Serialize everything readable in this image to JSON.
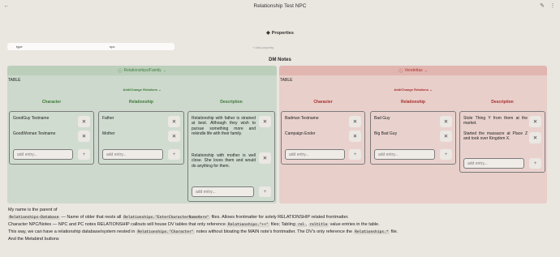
{
  "title": "Relationship Test NPC",
  "properties": {
    "heading": "Properties",
    "row": {
      "key": "type",
      "value": "npc"
    },
    "add_label": "+ Add property"
  },
  "dm_notes_title": "DM Notes",
  "relationships": {
    "header": "Relationships/Family",
    "table_label": "TABLE",
    "add_change": "Add/Change Relations",
    "columns": {
      "character": {
        "label": "Character",
        "entries": [
          "GoodGuy Testname",
          "GoodWoman Testname"
        ],
        "placeholder": "add entry..."
      },
      "relationship": {
        "label": "Relationship",
        "entries": [
          "Father",
          "Mother"
        ],
        "placeholder": "add entry..."
      },
      "description": {
        "label": "Description",
        "entries": [
          "Relationship with father is strained at best. Although they wish to pursue something more and rekindle life with their family.",
          "Relationship with mother is well close. She loves them and would do anything for them."
        ],
        "placeholder": "add entry..."
      }
    }
  },
  "vendettas": {
    "header": "Vendettas",
    "table_label": "TABLE",
    "add_change": "Add/Change Relations",
    "columns": {
      "character": {
        "label": "Character",
        "entries": [
          "Badman Testname",
          "Campaign Ender"
        ],
        "placeholder": "add entry..."
      },
      "relationship": {
        "label": "Relationship",
        "entries": [
          "Bad Guy",
          "Big Bad Guy"
        ],
        "placeholder": "add entry..."
      },
      "description": {
        "label": "Description",
        "entries": [
          "Stole Thing Y from them at the market.",
          "Started the massacre at Place Z and took over Kingdom X."
        ],
        "placeholder": "add entry..."
      }
    }
  },
  "footer": {
    "line1": "My name is the parent of",
    "line2_code1": "Relationships-Database",
    "line2_text1": " — Name of older that nests all ",
    "line2_code2": "Relationships.\"EnterCharacterNameHere\"",
    "line2_text2": " files. Allows frontmatter for solely RELATIONSHIP related frontmatter.",
    "line3_text1": "Character NPC/Notes — NPC and PC notes RELATIONSHIP callouts will house DV tables that only reference ",
    "line3_code1": "Relationships.\"++\"",
    "line3_text2": " files; Tabling ",
    "line3_code2": "rel",
    "line3_text3": ", ",
    "line3_code3": "reltitle",
    "line3_text4": " value entries in the table.",
    "line4_text1": "This way, we can have a relationship database/system nested in ",
    "line4_code1": "Relationships.\"Character\"",
    "line4_text2": " notes without bloating the MAIN note's frontmatter. The DV's only reference the ",
    "line4_code2": "Relationships.*",
    "line4_text3": " file.",
    "line5": "And the Metabind buttons"
  }
}
